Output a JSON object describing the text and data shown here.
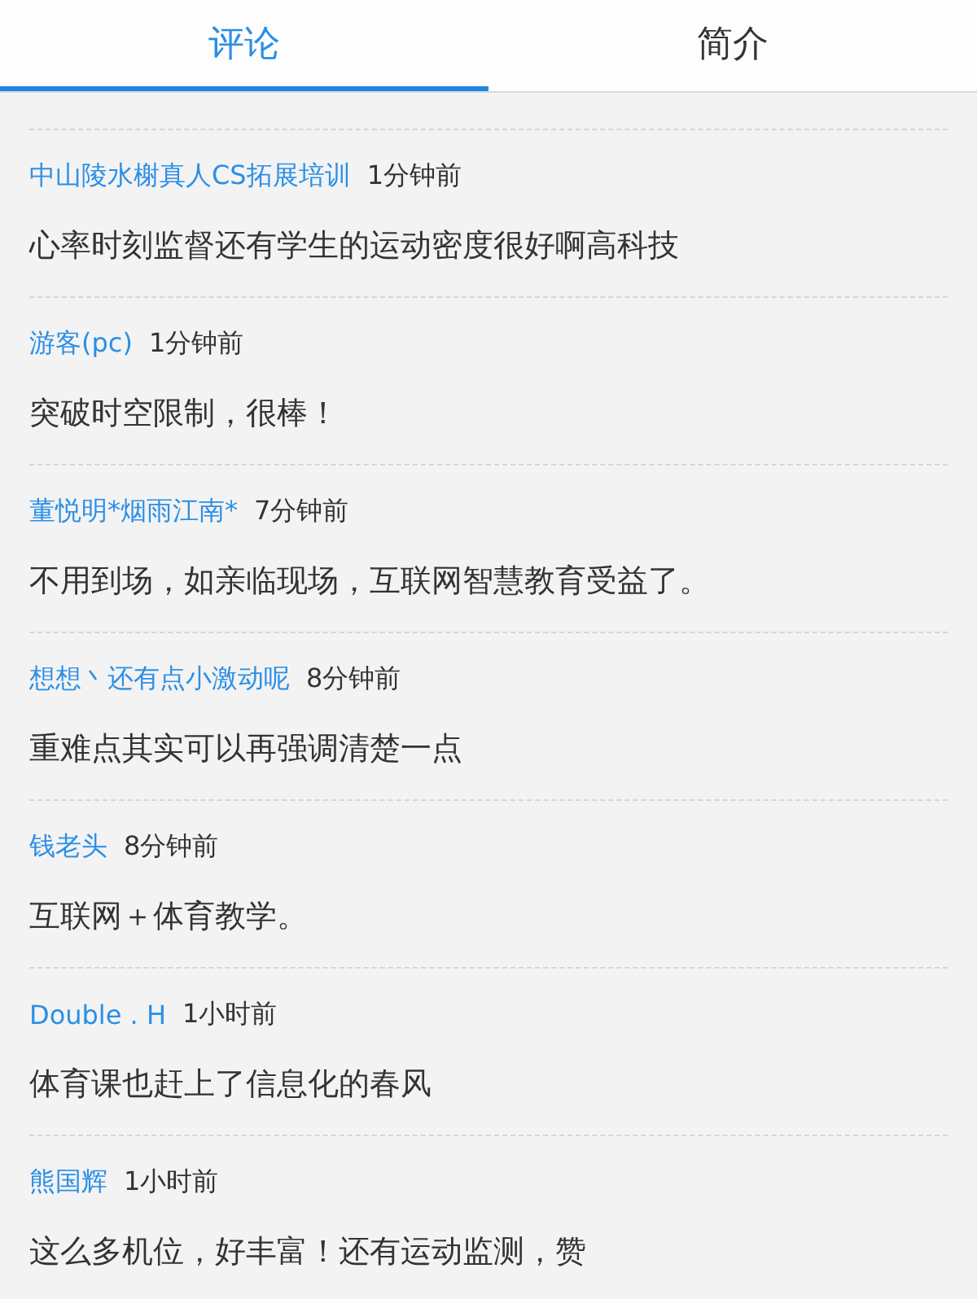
{
  "tabs": [
    {
      "label": "评论",
      "selected": true
    },
    {
      "label": "简介",
      "selected": false
    }
  ],
  "comments": [
    {
      "author": "中山陵水榭真人CS拓展培训",
      "time": "1分钟前",
      "text": "心率时刻监督还有学生的运动密度很好啊高科技"
    },
    {
      "author": "游客(pc)",
      "time": "1分钟前",
      "text": "突破时空限制，很棒！"
    },
    {
      "author": "董悦明*烟雨江南*",
      "time": "7分钟前",
      "text": "不用到场，如亲临现场，互联网智慧教育受益了。"
    },
    {
      "author": "想想丶还有点小激动呢",
      "time": "8分钟前",
      "text": "重难点其实可以再强调清楚一点"
    },
    {
      "author": "钱老头",
      "time": "8分钟前",
      "text": "互联网＋体育教学。"
    },
    {
      "author": "Double . H",
      "time": "1小时前",
      "text": "体育课也赶上了信息化的春风"
    },
    {
      "author": "熊国辉",
      "time": "1小时前",
      "text": "这么多机位，好丰富！还有运动监测，赞"
    }
  ]
}
